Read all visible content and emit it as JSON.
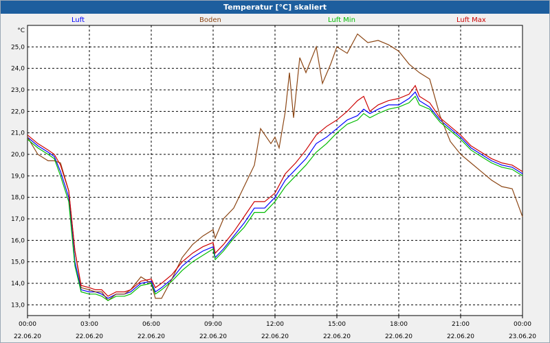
{
  "chart_data": {
    "type": "line",
    "title": "Temperatur [°C] skaliert",
    "ylabel": "°C",
    "ylim": [
      12.5,
      26.0
    ],
    "yticks": [
      "13,0",
      "14,0",
      "15,0",
      "16,0",
      "17,0",
      "18,0",
      "19,0",
      "20,0",
      "21,0",
      "22,0",
      "23,0",
      "24,0",
      "25,0"
    ],
    "xlim": [
      0,
      24
    ],
    "xticks": [
      {
        "time": "00:00",
        "date": "22.06.20"
      },
      {
        "time": "03:00",
        "date": "22.06.20"
      },
      {
        "time": "06:00",
        "date": "22.06.20"
      },
      {
        "time": "09:00",
        "date": "22.06.20"
      },
      {
        "time": "12:00",
        "date": "22.06.20"
      },
      {
        "time": "15:00",
        "date": "22.06.20"
      },
      {
        "time": "18:00",
        "date": "22.06.20"
      },
      {
        "time": "21:00",
        "date": "22.06.20"
      },
      {
        "time": "00:00",
        "date": "23.06.20"
      }
    ],
    "grid": true,
    "legend_placement": "top",
    "series": [
      {
        "name": "Luft",
        "color": "#0000ff",
        "points": [
          [
            0,
            20.8
          ],
          [
            0.5,
            20.4
          ],
          [
            1,
            20.1
          ],
          [
            1.3,
            19.9
          ],
          [
            1.6,
            19.2
          ],
          [
            2,
            18.0
          ],
          [
            2.3,
            15.0
          ],
          [
            2.6,
            13.7
          ],
          [
            3,
            13.6
          ],
          [
            3.3,
            13.6
          ],
          [
            3.6,
            13.5
          ],
          [
            3.9,
            13.3
          ],
          [
            4.3,
            13.5
          ],
          [
            4.7,
            13.5
          ],
          [
            5,
            13.6
          ],
          [
            5.5,
            14.0
          ],
          [
            6,
            14.1
          ],
          [
            6.2,
            13.6
          ],
          [
            6.5,
            13.8
          ],
          [
            7,
            14.2
          ],
          [
            7.5,
            14.8
          ],
          [
            8,
            15.2
          ],
          [
            8.5,
            15.5
          ],
          [
            9,
            15.7
          ],
          [
            9.1,
            15.2
          ],
          [
            9.5,
            15.6
          ],
          [
            10,
            16.2
          ],
          [
            10.5,
            16.8
          ],
          [
            11,
            17.5
          ],
          [
            11.5,
            17.5
          ],
          [
            12,
            18.0
          ],
          [
            12.5,
            18.8
          ],
          [
            13,
            19.3
          ],
          [
            13.5,
            19.8
          ],
          [
            14,
            20.5
          ],
          [
            14.5,
            20.8
          ],
          [
            15,
            21.2
          ],
          [
            15.5,
            21.6
          ],
          [
            16,
            21.8
          ],
          [
            16.3,
            22.1
          ],
          [
            16.6,
            21.9
          ],
          [
            17,
            22.1
          ],
          [
            17.5,
            22.3
          ],
          [
            18,
            22.3
          ],
          [
            18.5,
            22.6
          ],
          [
            18.8,
            22.9
          ],
          [
            19,
            22.5
          ],
          [
            19.5,
            22.2
          ],
          [
            20,
            21.6
          ],
          [
            20.5,
            21.2
          ],
          [
            21,
            20.8
          ],
          [
            21.5,
            20.3
          ],
          [
            22,
            20.0
          ],
          [
            22.5,
            19.7
          ],
          [
            23,
            19.5
          ],
          [
            23.5,
            19.4
          ],
          [
            24,
            19.1
          ]
        ]
      },
      {
        "name": "Boden",
        "color": "#8b4513",
        "points": [
          [
            0,
            20.8
          ],
          [
            0.5,
            20.0
          ],
          [
            1,
            19.7
          ],
          [
            1.3,
            19.7
          ],
          [
            1.6,
            19.6
          ],
          [
            2,
            18.3
          ],
          [
            2.3,
            15.5
          ],
          [
            2.6,
            13.8
          ],
          [
            3,
            13.7
          ],
          [
            3.3,
            13.6
          ],
          [
            3.6,
            13.6
          ],
          [
            3.9,
            13.2
          ],
          [
            4.3,
            13.5
          ],
          [
            4.7,
            13.5
          ],
          [
            5,
            13.7
          ],
          [
            5.5,
            14.3
          ],
          [
            6,
            14.0
          ],
          [
            6.2,
            13.3
          ],
          [
            6.5,
            13.3
          ],
          [
            7,
            14.2
          ],
          [
            7.5,
            15.2
          ],
          [
            8,
            15.8
          ],
          [
            8.5,
            16.2
          ],
          [
            9,
            16.5
          ],
          [
            9.1,
            16.1
          ],
          [
            9.5,
            17.0
          ],
          [
            10,
            17.5
          ],
          [
            10.5,
            18.5
          ],
          [
            11,
            19.5
          ],
          [
            11.3,
            21.2
          ],
          [
            11.8,
            20.5
          ],
          [
            12,
            20.8
          ],
          [
            12.2,
            20.3
          ],
          [
            12.5,
            22.0
          ],
          [
            12.7,
            23.8
          ],
          [
            12.9,
            21.7
          ],
          [
            13.2,
            24.5
          ],
          [
            13.5,
            23.8
          ],
          [
            14,
            25.0
          ],
          [
            14.3,
            23.3
          ],
          [
            14.7,
            24.2
          ],
          [
            15,
            25.0
          ],
          [
            15.5,
            24.7
          ],
          [
            16,
            25.6
          ],
          [
            16.5,
            25.2
          ],
          [
            17,
            25.3
          ],
          [
            17.5,
            25.1
          ],
          [
            18,
            24.8
          ],
          [
            18.5,
            24.2
          ],
          [
            19,
            23.8
          ],
          [
            19.5,
            23.5
          ],
          [
            20,
            21.8
          ],
          [
            20.5,
            20.6
          ],
          [
            21,
            20.0
          ],
          [
            21.5,
            19.6
          ],
          [
            22,
            19.2
          ],
          [
            22.5,
            18.8
          ],
          [
            23,
            18.5
          ],
          [
            23.5,
            18.4
          ],
          [
            24,
            17.1
          ]
        ]
      },
      {
        "name": "Luft Min",
        "color": "#00bb00",
        "points": [
          [
            0,
            20.7
          ],
          [
            0.5,
            20.3
          ],
          [
            1,
            20.0
          ],
          [
            1.3,
            19.8
          ],
          [
            1.6,
            19.0
          ],
          [
            2,
            17.8
          ],
          [
            2.3,
            14.8
          ],
          [
            2.6,
            13.6
          ],
          [
            3,
            13.5
          ],
          [
            3.3,
            13.5
          ],
          [
            3.6,
            13.4
          ],
          [
            3.9,
            13.2
          ],
          [
            4.3,
            13.4
          ],
          [
            4.7,
            13.4
          ],
          [
            5,
            13.5
          ],
          [
            5.5,
            13.9
          ],
          [
            6,
            14.0
          ],
          [
            6.2,
            13.5
          ],
          [
            6.5,
            13.7
          ],
          [
            7,
            14.1
          ],
          [
            7.5,
            14.6
          ],
          [
            8,
            15.0
          ],
          [
            8.5,
            15.3
          ],
          [
            9,
            15.6
          ],
          [
            9.1,
            15.1
          ],
          [
            9.5,
            15.5
          ],
          [
            10,
            16.1
          ],
          [
            10.5,
            16.6
          ],
          [
            11,
            17.3
          ],
          [
            11.5,
            17.3
          ],
          [
            12,
            17.8
          ],
          [
            12.5,
            18.5
          ],
          [
            13,
            19.0
          ],
          [
            13.5,
            19.5
          ],
          [
            14,
            20.1
          ],
          [
            14.5,
            20.5
          ],
          [
            15,
            21.0
          ],
          [
            15.5,
            21.4
          ],
          [
            16,
            21.6
          ],
          [
            16.3,
            21.9
          ],
          [
            16.6,
            21.7
          ],
          [
            17,
            21.9
          ],
          [
            17.5,
            22.1
          ],
          [
            18,
            22.2
          ],
          [
            18.5,
            22.4
          ],
          [
            18.8,
            22.7
          ],
          [
            19,
            22.3
          ],
          [
            19.5,
            22.1
          ],
          [
            20,
            21.5
          ],
          [
            20.5,
            21.1
          ],
          [
            21,
            20.7
          ],
          [
            21.5,
            20.2
          ],
          [
            22,
            19.9
          ],
          [
            22.5,
            19.6
          ],
          [
            23,
            19.4
          ],
          [
            23.5,
            19.3
          ],
          [
            24,
            19.0
          ]
        ]
      },
      {
        "name": "Luft Max",
        "color": "#cc0000",
        "points": [
          [
            0,
            20.9
          ],
          [
            0.5,
            20.5
          ],
          [
            1,
            20.2
          ],
          [
            1.3,
            20.0
          ],
          [
            1.6,
            19.5
          ],
          [
            2,
            18.3
          ],
          [
            2.3,
            15.5
          ],
          [
            2.6,
            13.9
          ],
          [
            3,
            13.8
          ],
          [
            3.3,
            13.7
          ],
          [
            3.6,
            13.7
          ],
          [
            3.9,
            13.4
          ],
          [
            4.3,
            13.6
          ],
          [
            4.7,
            13.6
          ],
          [
            5,
            13.7
          ],
          [
            5.5,
            14.1
          ],
          [
            6,
            14.2
          ],
          [
            6.2,
            13.8
          ],
          [
            6.5,
            14.0
          ],
          [
            7,
            14.4
          ],
          [
            7.5,
            15.0
          ],
          [
            8,
            15.4
          ],
          [
            8.5,
            15.7
          ],
          [
            9,
            15.9
          ],
          [
            9.1,
            15.4
          ],
          [
            9.5,
            15.8
          ],
          [
            10,
            16.4
          ],
          [
            10.5,
            17.1
          ],
          [
            11,
            17.8
          ],
          [
            11.5,
            17.8
          ],
          [
            12,
            18.2
          ],
          [
            12.5,
            19.1
          ],
          [
            13,
            19.6
          ],
          [
            13.5,
            20.2
          ],
          [
            14,
            20.9
          ],
          [
            14.5,
            21.3
          ],
          [
            15,
            21.6
          ],
          [
            15.5,
            22.0
          ],
          [
            16,
            22.5
          ],
          [
            16.3,
            22.7
          ],
          [
            16.6,
            22.0
          ],
          [
            17,
            22.3
          ],
          [
            17.5,
            22.5
          ],
          [
            18,
            22.6
          ],
          [
            18.5,
            22.8
          ],
          [
            18.8,
            23.2
          ],
          [
            19,
            22.7
          ],
          [
            19.5,
            22.4
          ],
          [
            20,
            21.7
          ],
          [
            20.5,
            21.3
          ],
          [
            21,
            20.9
          ],
          [
            21.5,
            20.4
          ],
          [
            22,
            20.1
          ],
          [
            22.5,
            19.8
          ],
          [
            23,
            19.6
          ],
          [
            23.5,
            19.5
          ],
          [
            24,
            19.2
          ]
        ]
      }
    ]
  }
}
